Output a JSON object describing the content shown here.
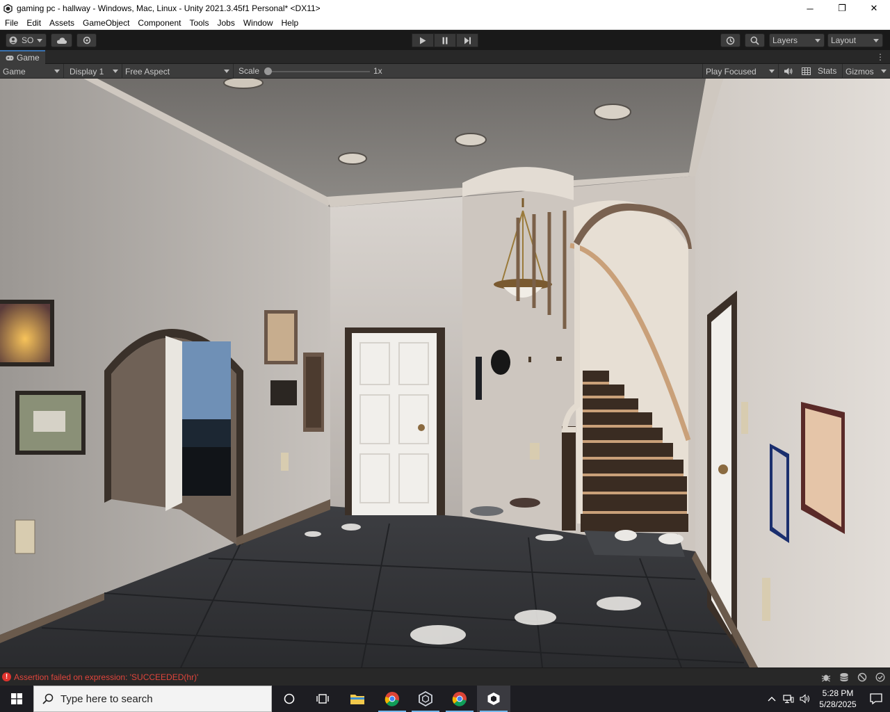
{
  "window": {
    "title": "gaming pc - hallway - Windows, Mac, Linux - Unity 2021.3.45f1 Personal* <DX11>",
    "minimize_label": "─",
    "restore_label": "❐",
    "close_label": "✕"
  },
  "menu": {
    "items": [
      "File",
      "Edit",
      "Assets",
      "GameObject",
      "Component",
      "Tools",
      "Jobs",
      "Window",
      "Help"
    ]
  },
  "toolbar": {
    "account_label": "SO",
    "layers_label": "Layers",
    "layout_label": "Layout"
  },
  "panel": {
    "tab_label": "Game",
    "menu_glyph": "⋮"
  },
  "game_toolbar": {
    "view_mode": "Game",
    "display": "Display 1",
    "aspect": "Free Aspect",
    "scale_label": "Scale",
    "scale_value": "1x",
    "scale_fraction": 0.0,
    "play_mode": "Play Focused",
    "stats_label": "Stats",
    "gizmos_label": "Gizmos"
  },
  "status": {
    "error_glyph": "!",
    "message": "Assertion failed on expression: 'SUCCEEDED(hr)'"
  },
  "taskbar": {
    "search_placeholder": "Type here to search",
    "time": "5:28 PM",
    "date": "5/28/2025"
  },
  "colors": {
    "unity_bg": "#191919",
    "panel_bg": "#3c3c3c",
    "error_red": "#e0332e",
    "taskbar_bg": "#1d1d22",
    "accent_blue": "#3a72b0"
  }
}
